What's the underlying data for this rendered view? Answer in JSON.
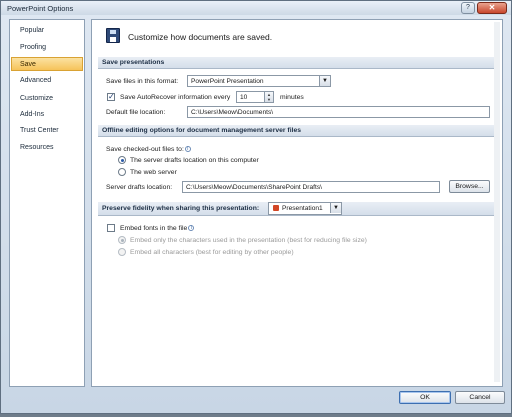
{
  "window": {
    "title": "PowerPoint Options",
    "help": "?",
    "close": "✕"
  },
  "sidebar": {
    "items": [
      {
        "label": "Popular"
      },
      {
        "label": "Proofing"
      },
      {
        "label": "Save"
      },
      {
        "label": "Advanced"
      },
      {
        "label": "Customize"
      },
      {
        "label": "Add-Ins"
      },
      {
        "label": "Trust Center"
      },
      {
        "label": "Resources"
      }
    ],
    "selected": "Save"
  },
  "header": {
    "text": "Customize how documents are saved.",
    "icon": "floppy-disk-icon"
  },
  "save_presentations": {
    "title": "Save presentations",
    "format_label": "Save files in this format:",
    "format_value": "PowerPoint Presentation",
    "autorecover_label": "Save AutoRecover information every",
    "autorecover_checked": true,
    "autorecover_value": "10",
    "autorecover_unit": "minutes",
    "default_location_label": "Default file location:",
    "default_location_value": "C:\\Users\\Meow\\Documents\\"
  },
  "offline": {
    "title": "Offline editing options for document management server files",
    "checked_out_label": "Save checked-out files to:",
    "radio_server": "The server drafts location on this computer",
    "radio_web": "The web server",
    "selected": "server",
    "drafts_label": "Server drafts location:",
    "drafts_value": "C:\\Users\\Meow\\Documents\\SharePoint Drafts\\",
    "browse_label": "Browse..."
  },
  "fidelity": {
    "title": "Preserve fidelity when sharing this presentation:",
    "presentation_value": "Presentation1",
    "embed_label": "Embed fonts in the file",
    "embed_checked": false,
    "embed_used": "Embed only the characters used in the presentation (best for reducing file size)",
    "embed_all": "Embed all characters (best for editing by other people)"
  },
  "footer": {
    "ok": "OK",
    "cancel": "Cancel"
  }
}
